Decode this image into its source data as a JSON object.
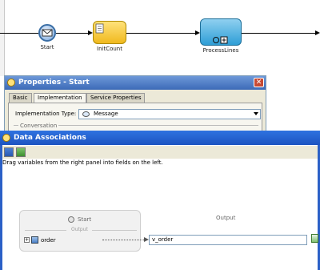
{
  "canvas": {
    "start_label": "Start",
    "task1_label": "InitCount",
    "task2_label": "ProcessLines"
  },
  "properties": {
    "title": "Properties - Start",
    "tabs": [
      {
        "label": "Basic"
      },
      {
        "label": "Implementation"
      },
      {
        "label": "Service Properties"
      }
    ],
    "active_tab": "Implementation",
    "impl_type_label": "Implementation Type:",
    "impl_type_value": "Message",
    "section_label": "Conversation",
    "close_label": "✕"
  },
  "data_associations": {
    "title": "Data Associations",
    "hint": "Drag variables from the right panel into fields on the left.",
    "source": {
      "header": "Start",
      "divider": "Output",
      "item": "order"
    },
    "target": {
      "header": "Output",
      "field_value": "v_order"
    }
  }
}
